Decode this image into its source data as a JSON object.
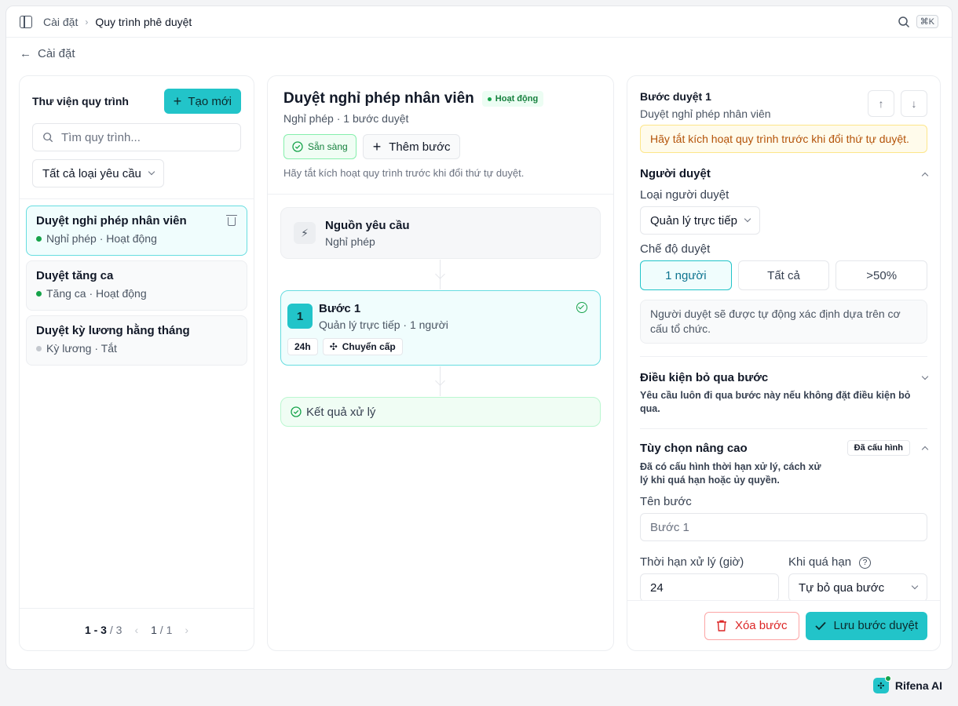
{
  "breadcrumb": {
    "parent": "Cài đặt",
    "current": "Quy trình phê duyệt",
    "shortcut": "⌘K"
  },
  "back_label": "Cài đặt",
  "library": {
    "title": "Thư viện quy trình",
    "create_label": "Tạo mới",
    "search_placeholder": "Tìm quy trình...",
    "filter_value": "Tất cả loại yêu cầu",
    "items": [
      {
        "name": "Duyệt nghỉ phép nhân viên",
        "meta": "Nghỉ phép · Hoạt động",
        "status": "active"
      },
      {
        "name": "Duyệt tăng ca",
        "meta": "Tăng ca · Hoạt động",
        "status": "active"
      },
      {
        "name": "Duyệt kỳ lương hằng tháng",
        "meta": "Kỳ lương · Tắt",
        "status": "off"
      }
    ],
    "pagination": {
      "range": "1 - 3",
      "total": "/ 3",
      "page": "1",
      "pages": "/ 1"
    }
  },
  "workflow": {
    "title": "Duyệt nghỉ phép nhân viên",
    "status_badge": "Hoạt động",
    "subtitle": "Nghỉ phép · 1 bước duyệt",
    "ready_label": "Sẵn sàng",
    "add_step_label": "Thêm bước",
    "hint": "Hãy tắt kích hoạt quy trình trước khi đổi thứ tự duyệt.",
    "source": {
      "title": "Nguồn yêu cầu",
      "subtitle": "Nghỉ phép"
    },
    "step": {
      "number": "1",
      "title": "Bước 1",
      "subtitle": "Quản lý trực tiếp · 1 người",
      "tag_time": "24h",
      "tag_escalate": "Chuyển cấp"
    },
    "result_label": "Kết quả xử lý"
  },
  "detail": {
    "title": "Bước duyệt 1",
    "subtitle": "Duyệt nghỉ phép nhân viên",
    "warning": "Hãy tắt kích hoạt quy trình trước khi đổi thứ tự duyệt.",
    "approver": {
      "heading": "Người duyệt",
      "type_label": "Loại người duyệt",
      "type_value": "Quản lý trực tiếp",
      "mode_label": "Chế độ duyệt",
      "modes": [
        "1 người",
        "Tất cả",
        ">50%"
      ],
      "selected_mode": "1 người",
      "note": "Người duyệt sẽ được tự động xác định dựa trên cơ cấu tổ chức."
    },
    "skip": {
      "heading": "Điều kiện bỏ qua bước",
      "desc": "Yêu cầu luôn đi qua bước này nếu không đặt điều kiện bỏ qua."
    },
    "advanced": {
      "heading": "Tùy chọn nâng cao",
      "badge": "Đã cấu hình",
      "desc": "Đã có cấu hình thời hạn xử lý, cách xử lý khi quá hạn hoặc ủy quyền.",
      "name_label": "Tên bước",
      "name_placeholder": "Bước 1",
      "deadline_label": "Thời hạn xử lý (giờ)",
      "deadline_value": "24",
      "overdue_label": "Khi quá hạn",
      "overdue_value": "Tự bỏ qua bước"
    },
    "delete_label": "Xóa bước",
    "save_label": "Lưu bước duyệt"
  },
  "brand": "Rifena AI",
  "colors": {
    "accent": "#22c4c9",
    "success": "#16a34a",
    "danger": "#dc2626",
    "warning": "#b45309"
  }
}
